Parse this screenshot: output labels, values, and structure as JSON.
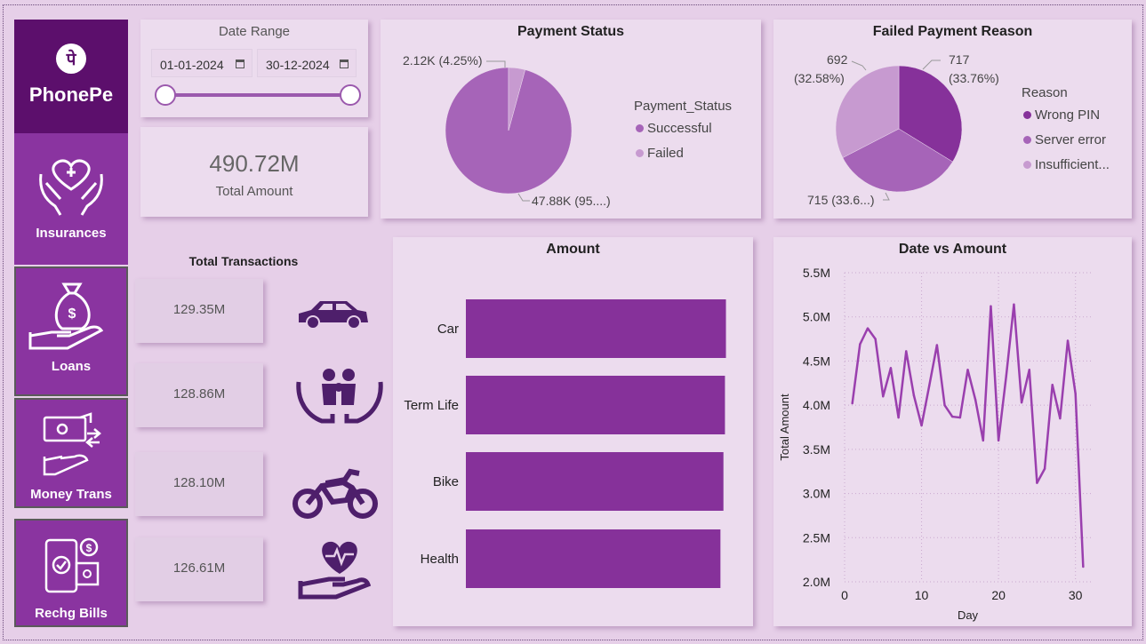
{
  "brand": {
    "name": "PhonePe",
    "logo_glyph": "पे"
  },
  "sidebar": {
    "items": [
      {
        "label": "Insurances",
        "icon": "hands-heart-cross-icon"
      },
      {
        "label": "Loans",
        "icon": "money-bag-hand-icon"
      },
      {
        "label": "Money Trans",
        "icon": "cash-transfer-icon"
      },
      {
        "label": "Rechg Bills",
        "icon": "phone-bill-icon"
      }
    ]
  },
  "date_range": {
    "title": "Date Range",
    "start": "01-01-2024",
    "end": "30-12-2024",
    "slider_start": 0,
    "slider_end": 1
  },
  "kpi": {
    "value": "490.72M",
    "label": "Total Amount"
  },
  "transactions": {
    "title": "Total Transactions",
    "items": [
      {
        "value": "129.35M",
        "icon": "car-icon"
      },
      {
        "value": "128.86M",
        "icon": "family-hands-icon"
      },
      {
        "value": "128.10M",
        "icon": "motorbike-icon"
      },
      {
        "value": "126.61M",
        "icon": "heart-pulse-hand-icon"
      }
    ]
  },
  "colors": {
    "dark": "#86319a",
    "mid": "#a664b8",
    "light": "#c79ad0",
    "line": "#9a3fae",
    "bg": "#e6cfe8",
    "card": "#ecdcee"
  },
  "chart_data": [
    {
      "type": "pie",
      "title": "Payment Status",
      "legend_title": "Payment_Status",
      "legend_position": "right",
      "labels": [
        "Successful",
        "Failed"
      ],
      "values": [
        47880,
        2120
      ],
      "data_labels": [
        "47.88K (95....)",
        "2.12K (4.25%)"
      ],
      "colors": [
        "#a664b8",
        "#c79ad0"
      ]
    },
    {
      "type": "pie",
      "title": "Failed Payment Reason",
      "legend_title": "Reason",
      "legend_position": "right",
      "labels": [
        "Wrong PIN",
        "Server error",
        "Insufficient..."
      ],
      "values": [
        717,
        715,
        692
      ],
      "data_labels_line1": [
        "717",
        "715 (33.6...)",
        "692"
      ],
      "data_labels_line2": [
        "(33.76%)",
        "",
        "(32.58%)"
      ],
      "colors": [
        "#86319a",
        "#a664b8",
        "#c79ad0"
      ]
    },
    {
      "type": "bar",
      "orientation": "horizontal",
      "title": "Amount",
      "categories": [
        "Car",
        "Term Life",
        "Bike",
        "Health"
      ],
      "values": [
        129.35,
        128.86,
        128.1,
        126.61
      ],
      "xlim": [
        0,
        130
      ]
    },
    {
      "type": "line",
      "title": "Date vs Amount",
      "xlabel": "Day",
      "ylabel": "Total Amount",
      "x": [
        1,
        2,
        3,
        4,
        5,
        6,
        7,
        8,
        9,
        10,
        11,
        12,
        13,
        14,
        15,
        16,
        17,
        18,
        19,
        20,
        21,
        22,
        23,
        24,
        25,
        26,
        27,
        28,
        29,
        30,
        31
      ],
      "y": [
        4.02,
        4.69,
        4.87,
        4.75,
        4.1,
        4.42,
        3.86,
        4.61,
        4.11,
        3.77,
        4.22,
        4.68,
        4.0,
        3.87,
        3.86,
        4.4,
        4.06,
        3.6,
        5.12,
        3.6,
        4.33,
        5.14,
        4.03,
        4.4,
        3.12,
        3.28,
        4.23,
        3.85,
        4.73,
        4.13,
        2.17
      ],
      "xlim": [
        0,
        32
      ],
      "ylim": [
        2.0,
        5.5
      ],
      "xticks": [
        "0",
        "10",
        "20",
        "30"
      ],
      "yticks": [
        "2.0M",
        "2.5M",
        "3.0M",
        "3.5M",
        "4.0M",
        "4.5M",
        "5.0M",
        "5.5M"
      ],
      "grid": true
    }
  ]
}
